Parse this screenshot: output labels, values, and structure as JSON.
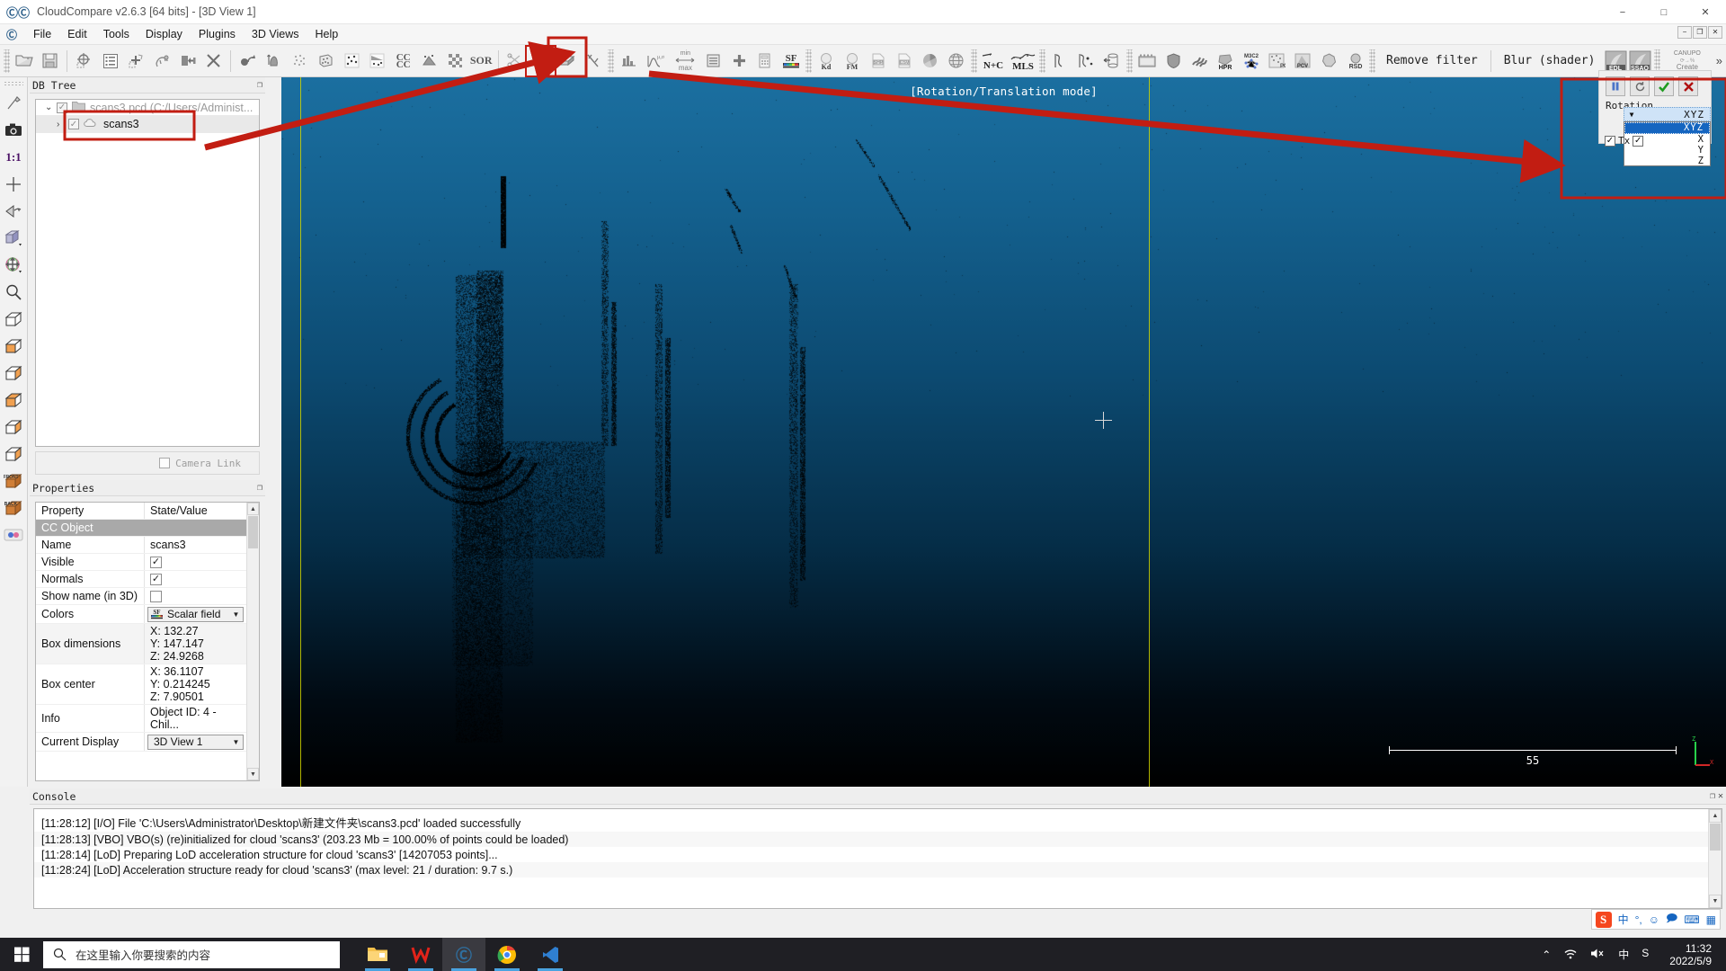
{
  "window": {
    "title": "CloudCompare v2.6.3 [64 bits] - [3D View 1]",
    "app_icon": "cloudcompare-icon",
    "minimize": "−",
    "maximize": "□",
    "close": "✕",
    "mdi_minimize": "−",
    "mdi_restore": "❐",
    "mdi_close": "✕"
  },
  "menu": {
    "items": [
      {
        "label": "File",
        "mnemonic": "F"
      },
      {
        "label": "Edit",
        "mnemonic": "E"
      },
      {
        "label": "Tools",
        "mnemonic": "T"
      },
      {
        "label": "Display",
        "mnemonic": "D"
      },
      {
        "label": "Plugins",
        "mnemonic": "P"
      },
      {
        "label": "3D Views",
        "mnemonic": "V"
      },
      {
        "label": "Help",
        "mnemonic": "H"
      }
    ]
  },
  "toolbar": {
    "remove_filter_label": "Remove filter",
    "blur_shader_label": "Blur (shader)",
    "edl_label": "EDL",
    "ssao_label": "SSAO",
    "canupo_label": "CANUPO",
    "create_label": "Create",
    "overflow_label": "»",
    "buttons": [
      {
        "name": "open-file-icon",
        "hint": "Open"
      },
      {
        "name": "save-file-icon",
        "hint": "Save"
      },
      {
        "name": "global-shift-icon",
        "hint": "Global shift settings"
      },
      {
        "name": "properties-list-icon",
        "hint": "Toggle DB tree"
      },
      {
        "name": "segment-icon",
        "hint": "Segment"
      },
      {
        "name": "clone-icon",
        "hint": "Clone"
      },
      {
        "name": "merge-icon",
        "hint": "Merge"
      },
      {
        "name": "delete-icon",
        "hint": "Delete"
      },
      {
        "name": "transform-icon",
        "hint": "Apply transformation"
      },
      {
        "name": "normals-icon",
        "hint": "Compute normals"
      },
      {
        "name": "subsample-icon",
        "hint": "Subsample"
      },
      {
        "name": "cloud-bbox-icon",
        "hint": "Bounding box"
      },
      {
        "name": "sample-points-icon",
        "hint": "Sample points"
      },
      {
        "name": "fit-plane-icon",
        "hint": "Fit plane"
      },
      {
        "name": "cc-cc-icon",
        "hint": "Cloud/Cloud dist"
      },
      {
        "name": "cloud-mesh-dist-icon",
        "hint": "Cloud/Mesh dist"
      },
      {
        "name": "checker-icon",
        "hint": "Registration"
      },
      {
        "name": "sor-filter-icon",
        "hint": "SOR filter"
      },
      {
        "name": "scissors-icon",
        "hint": "Crop"
      },
      {
        "name": "translate-rotate-icon",
        "hint": "Translate/Rotate",
        "selected": true
      },
      {
        "name": "box-icon",
        "hint": "Box"
      },
      {
        "name": "lightning-icon",
        "hint": "Interpolate"
      },
      {
        "name": "histogram-icon",
        "hint": "Histogram"
      },
      {
        "name": "gaussian-icon",
        "hint": "Gaussian filter"
      },
      {
        "name": "minmax-icon",
        "hint": "Min/Max"
      },
      {
        "name": "sf-delete-icon",
        "hint": "Delete scalar field"
      },
      {
        "name": "sf-add-icon",
        "hint": "Add scalar field"
      },
      {
        "name": "calculator-icon",
        "hint": "SF arithmetic"
      },
      {
        "name": "sf-icon",
        "hint": "Scalar field"
      },
      {
        "name": "kd-tree-icon",
        "hint": "Kd-tree"
      },
      {
        "name": "fm-icon",
        "hint": "Fast marching"
      },
      {
        "name": "shp-export-icon",
        "hint": "Export SHP"
      },
      {
        "name": "csv-export-icon",
        "hint": "Export CSV"
      },
      {
        "name": "pie-icon",
        "hint": "Statistics"
      },
      {
        "name": "globe-icon",
        "hint": "Geo"
      },
      {
        "name": "n-plus-c-icon",
        "hint": "Normals+Curvature"
      },
      {
        "name": "mls-icon",
        "hint": "MLS smoothing"
      },
      {
        "name": "poly-icon",
        "hint": "Polyline"
      },
      {
        "name": "point-pick-icon",
        "hint": "Point picking"
      },
      {
        "name": "rotate-section-icon",
        "hint": "Section"
      },
      {
        "name": "film-icon",
        "hint": "Animation"
      },
      {
        "name": "shield-icon",
        "hint": "Qhull"
      },
      {
        "name": "waves-icon",
        "hint": "Waveform"
      },
      {
        "name": "hpr-icon",
        "hint": "HPR"
      },
      {
        "name": "m3c2-icon",
        "hint": "M3C2"
      },
      {
        "name": "pcd-icon",
        "hint": "PCD"
      },
      {
        "name": "pcv-icon",
        "hint": "PCV"
      },
      {
        "name": "poisson-icon",
        "hint": "Poisson recon"
      },
      {
        "name": "rsd-icon",
        "hint": "RSD"
      }
    ]
  },
  "left_toolbar": {
    "buttons": [
      {
        "name": "pick-rotation-center-icon"
      },
      {
        "name": "camera-snapshot-icon"
      },
      {
        "name": "zoom-1-1-icon",
        "label": "1:1"
      },
      {
        "name": "center-view-icon"
      },
      {
        "name": "toggle-perspective-icon"
      },
      {
        "name": "display-options-icon"
      },
      {
        "name": "rotation-axis-icon"
      },
      {
        "name": "zoom-icon"
      },
      {
        "name": "view-top-icon"
      },
      {
        "name": "view-bottom-icon"
      },
      {
        "name": "view-left-icon"
      },
      {
        "name": "view-right-icon"
      },
      {
        "name": "view-iso1-icon"
      },
      {
        "name": "view-iso2-icon"
      },
      {
        "name": "view-front-icon",
        "label": "FRONT"
      },
      {
        "name": "view-back-icon",
        "label": "BACK"
      },
      {
        "name": "stereo-mode-icon"
      }
    ]
  },
  "db_tree": {
    "title": "DB Tree",
    "items": [
      {
        "expander": "⌄",
        "checked": true,
        "icon": "folder-icon",
        "label": "scans3.pcd (C:/Users/Administ...",
        "level": 0,
        "dim": true
      },
      {
        "expander": "›",
        "checked": true,
        "icon": "cloud-icon",
        "label": "scans3",
        "level": 1,
        "selected": true
      }
    ],
    "camera_link_label": "Camera Link",
    "camera_link_checked": false
  },
  "properties": {
    "title": "Properties",
    "headers": [
      "Property",
      "State/Value"
    ],
    "section_label": "CC Object",
    "rows": [
      {
        "label": "Name",
        "type": "text",
        "value": "scans3"
      },
      {
        "label": "Visible",
        "type": "checkbox",
        "checked": true
      },
      {
        "label": "Normals",
        "type": "checkbox",
        "checked": true
      },
      {
        "label": "Show name (in 3D)",
        "type": "checkbox",
        "checked": false
      },
      {
        "label": "Colors",
        "type": "combo",
        "value": "Scalar field",
        "icon": "sf-icon"
      },
      {
        "label": "Box dimensions",
        "type": "triplet",
        "values": [
          "X: 132.27",
          "Y: 147.147",
          "Z: 24.9268"
        ]
      },
      {
        "label": "Box center",
        "type": "triplet",
        "values": [
          "X: 36.1107",
          "Y: 0.214245",
          "Z: 7.90501"
        ]
      },
      {
        "label": "Info",
        "type": "text",
        "value": "Object ID: 4 - Chil..."
      },
      {
        "label": "Current Display",
        "type": "combo",
        "value": "3D View 1"
      }
    ]
  },
  "view3d": {
    "mode_label": "[Rotation/Translation mode]",
    "scale_value": "55",
    "axis_labels": {
      "z": "Z",
      "x": "X"
    }
  },
  "rotation_dialog": {
    "pause_icon": "pause-icon",
    "reset_icon": "reset-icon",
    "apply_icon": "apply-check-icon",
    "cancel_icon": "cancel-cross-icon",
    "rotation_label": "Rotation",
    "selected_axis": "XYZ",
    "options": [
      "XYZ",
      "X",
      "Y",
      "Z"
    ],
    "tx_label": "Tx",
    "tx_checked": true,
    "ty_checked": true
  },
  "console": {
    "title": "Console",
    "lines": [
      "[11:28:12] [I/O] File 'C:\\Users\\Administrator\\Desktop\\新建文件夹\\scans3.pcd' loaded successfully",
      "[11:28:13] [VBO] VBO(s) (re)initialized for cloud 'scans3' (203.23 Mb = 100.00% of points could be loaded)",
      "[11:28:14] [LoD] Preparing LoD acceleration structure for cloud 'scans3' [14207053 points]...",
      "[11:28:24] [LoD] Acceleration structure ready for cloud 'scans3' (max level: 21 / duration: 9.7 s.)"
    ]
  },
  "ime_bar": {
    "items": [
      "sogou-icon",
      "中",
      "°,",
      "smiley-icon",
      "expression-icon",
      "keyboard-icon",
      "apps-icon"
    ]
  },
  "taskbar": {
    "start_icon": "windows-start-icon",
    "search_icon": "search-icon",
    "search_placeholder": "在这里输入你要搜索的内容",
    "apps": [
      {
        "name": "file-explorer-icon",
        "running": true,
        "active": false
      },
      {
        "name": "wps-icon",
        "running": true,
        "active": false
      },
      {
        "name": "cloudcompare-icon",
        "running": true,
        "active": true
      },
      {
        "name": "chrome-icon",
        "running": true,
        "active": false
      },
      {
        "name": "vscode-icon",
        "running": true,
        "active": false
      }
    ],
    "tray": [
      "chevron-up-icon",
      "wifi-icon",
      "volume-mute-icon",
      "中",
      "sogou-icon"
    ],
    "clock_time": "11:32",
    "clock_date": "2022/5/9"
  },
  "colors": {
    "accent_red": "#c21d12",
    "viewport_top": "#1b6fa0",
    "axis_yellow": "#cfd400",
    "selection_blue": "#1565c0"
  }
}
